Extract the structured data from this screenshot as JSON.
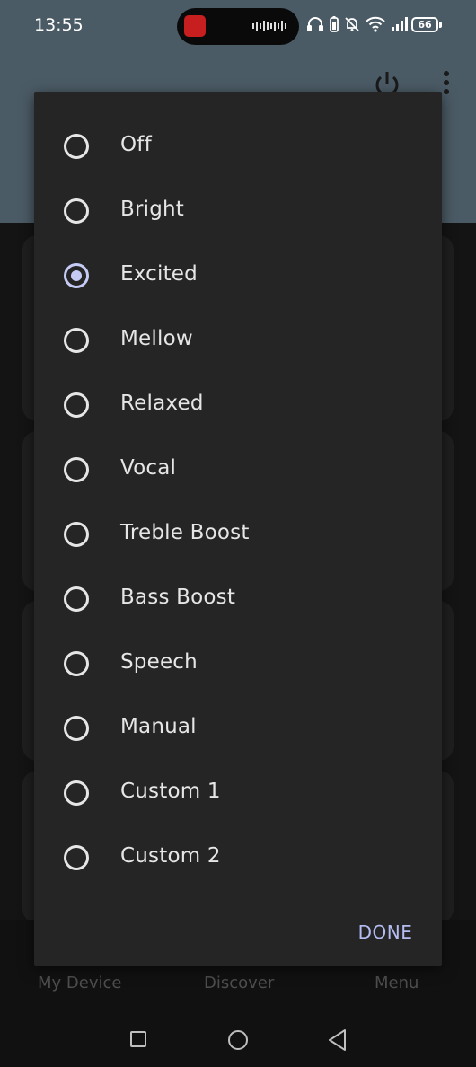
{
  "status_bar": {
    "time": "13:55",
    "battery": "66"
  },
  "dialog": {
    "options": [
      {
        "label": "Off",
        "checked": false
      },
      {
        "label": "Bright",
        "checked": false
      },
      {
        "label": "Excited",
        "checked": true
      },
      {
        "label": "Mellow",
        "checked": false
      },
      {
        "label": "Relaxed",
        "checked": false
      },
      {
        "label": "Vocal",
        "checked": false
      },
      {
        "label": "Treble Boost",
        "checked": false
      },
      {
        "label": "Bass Boost",
        "checked": false
      },
      {
        "label": "Speech",
        "checked": false
      },
      {
        "label": "Manual",
        "checked": false
      },
      {
        "label": "Custom 1",
        "checked": false
      },
      {
        "label": "Custom 2",
        "checked": false
      }
    ],
    "done_label": "DONE"
  },
  "bottom_nav": {
    "items": [
      {
        "label": "My Device"
      },
      {
        "label": "Discover"
      },
      {
        "label": "Menu"
      }
    ]
  },
  "colors": {
    "accent": "#c5cbf5",
    "dialog_bg": "#252525",
    "appbar_bg": "#4b5b66"
  }
}
